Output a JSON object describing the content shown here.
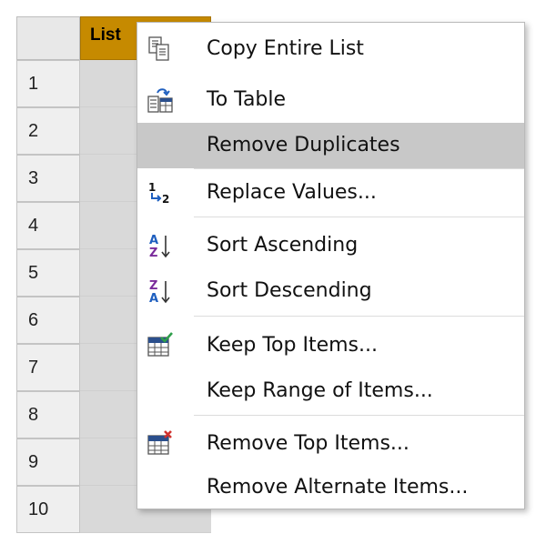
{
  "grid": {
    "column_header": "List",
    "row_numbers": [
      "1",
      "2",
      "3",
      "4",
      "5",
      "6",
      "7",
      "8",
      "9",
      "10"
    ]
  },
  "context_menu": {
    "items": [
      {
        "label": "Copy Entire List",
        "icon": "copy-icon"
      },
      {
        "label": "To Table",
        "icon": "to-table-icon"
      },
      {
        "label": "Remove Duplicates",
        "icon": "",
        "highlighted": true
      },
      {
        "label": "Replace Values...",
        "icon": "replace-values-icon"
      },
      {
        "label": "Sort Ascending",
        "icon": "sort-ascending-icon"
      },
      {
        "label": "Sort Descending",
        "icon": "sort-descending-icon"
      },
      {
        "label": "Keep Top Items...",
        "icon": "keep-top-items-icon"
      },
      {
        "label": "Keep Range of Items...",
        "icon": ""
      },
      {
        "label": "Remove Top Items...",
        "icon": "remove-top-items-icon"
      },
      {
        "label": "Remove Alternate Items...",
        "icon": ""
      }
    ]
  },
  "colors": {
    "header_accent": "#c68a00",
    "highlight": "#c8c8c8",
    "sort_letter_a": "#1f5fbf",
    "sort_letter_z": "#7a2b9b",
    "check_green": "#2e9e4a",
    "remove_red": "#d0312d",
    "table_header_blue": "#2b4f8c"
  }
}
